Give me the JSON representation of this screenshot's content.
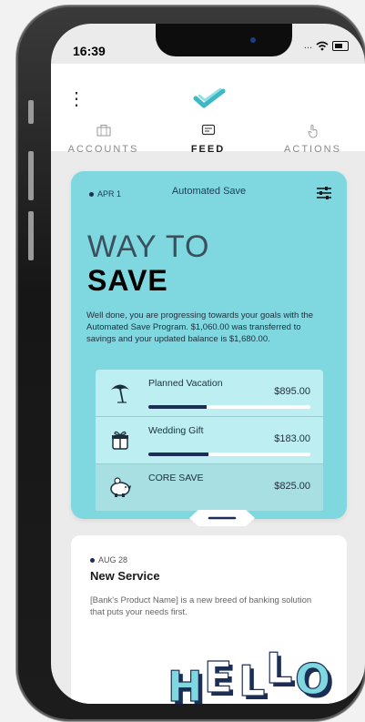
{
  "status": {
    "time": "16:39",
    "signal": "..."
  },
  "tabs": [
    {
      "label": "ACCOUNTS",
      "icon": "briefcase-icon"
    },
    {
      "label": "FEED",
      "icon": "feed-icon"
    },
    {
      "label": "ACTIONS",
      "icon": "tap-hand-icon"
    }
  ],
  "save_card": {
    "date": "APR 1",
    "tag": "Automated Save",
    "title_light": "WAY TO",
    "title_bold": "SAVE",
    "message": "Well done, you are progressing towards your goals with the Automated Save Program. $1,060.00 was transferred to savings and your updated balance is $1,680.00.",
    "goals": [
      {
        "name": "Planned Vacation",
        "amount": "$895.00",
        "icon": "beach-umbrella-icon",
        "progress": 0.36
      },
      {
        "name": "Wedding Gift",
        "amount": "$183.00",
        "icon": "gift-icon",
        "progress": 0.37
      },
      {
        "name": "CORE SAVE",
        "amount": "$825.00",
        "icon": "piggy-bank-icon"
      }
    ]
  },
  "news_card": {
    "date": "AUG 28",
    "title": "New Service",
    "body": "[Bank's Product Name] is a new breed of banking solution that puts your needs first.",
    "hello_letters": [
      "H",
      "E",
      "L",
      "L",
      "O"
    ]
  },
  "colors": {
    "card": "#7fd8e0",
    "accent": "#1c2e55",
    "logo": "#3fb8c6"
  }
}
